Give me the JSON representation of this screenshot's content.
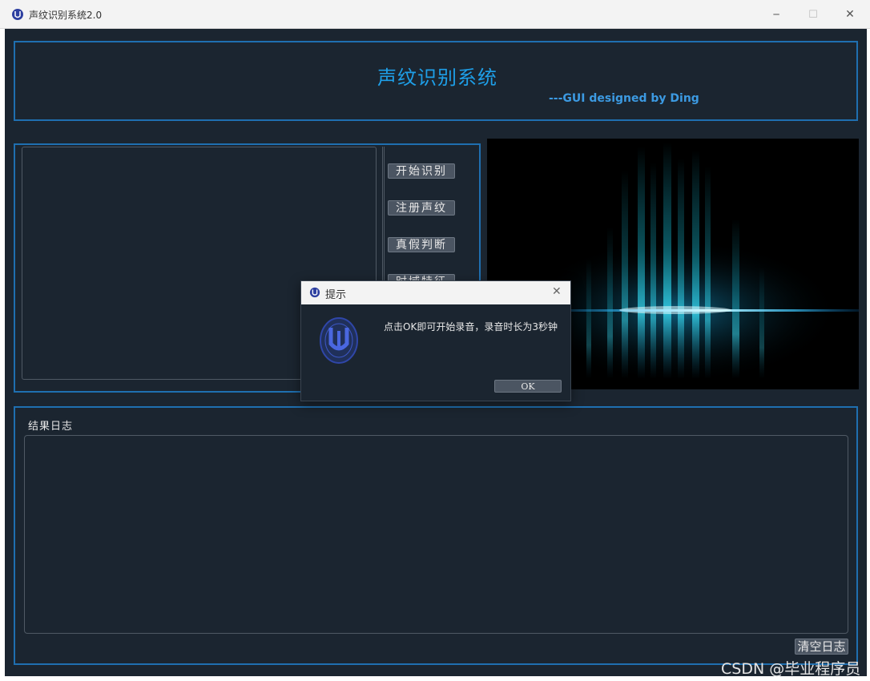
{
  "window": {
    "title": "声纹识别系统2.0",
    "app_icon": "university-seal-icon",
    "controls": {
      "minimize": "─",
      "maximize": "☐",
      "close": "✕"
    }
  },
  "header": {
    "title": "声纹识别系统",
    "subtitle": "---GUI designed by Ding"
  },
  "side_buttons": [
    {
      "label": "开始识别"
    },
    {
      "label": "注册声纹"
    },
    {
      "label": "真假判断"
    },
    {
      "label": "时域特征"
    }
  ],
  "log": {
    "label": "结果日志",
    "clear_label": "清空日志"
  },
  "dialog": {
    "title": "提示",
    "message": "点击OK即可开始录音，录音时长为3秒钟",
    "ok_label": "OK",
    "close": "✕"
  },
  "watermark": "CSDN @毕业程序员",
  "colors": {
    "background": "#1b2530",
    "border_accent": "#1f6fb0",
    "title_blue": "#1e9fe8",
    "button_gray": "#4b5562",
    "glow_cyan": "#19d2f0"
  }
}
